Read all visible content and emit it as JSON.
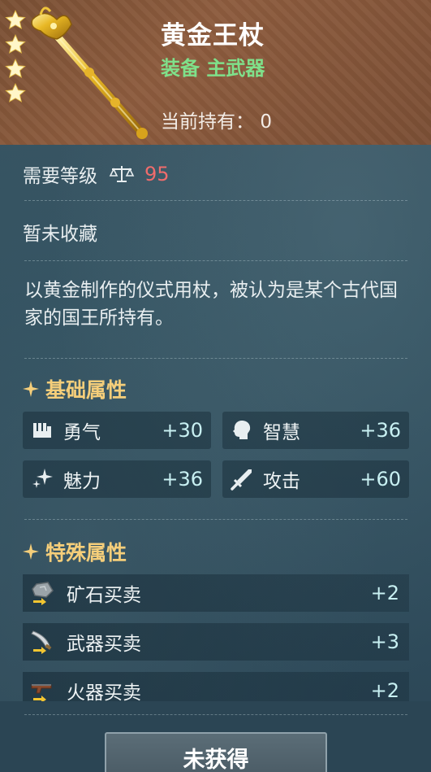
{
  "item": {
    "name": "黄金王杖",
    "type": "装备 主武器",
    "owned_label": "当前持有",
    "owned_sep": "：",
    "owned_count": "0",
    "stars": 4
  },
  "requirement": {
    "label": "需要等级",
    "icon": "scale-icon",
    "value": "95",
    "value_color": "#f06c6c"
  },
  "collection_status": "暂未收藏",
  "description": "以黄金制作的仪式用杖，被认为是某个古代国家的国王所持有。",
  "basic_attributes": {
    "title": "基础属性",
    "items": [
      {
        "name": "勇气",
        "value": "+30",
        "icon": "fist-icon"
      },
      {
        "name": "智慧",
        "value": "+36",
        "icon": "head-icon"
      },
      {
        "name": "魅力",
        "value": "+36",
        "icon": "sparkle-icon"
      },
      {
        "name": "攻击",
        "value": "+60",
        "icon": "sword-icon"
      }
    ]
  },
  "special_attributes": {
    "title": "特殊属性",
    "items": [
      {
        "name": "矿石买卖",
        "value": "+2",
        "icon": "ore-trade-icon"
      },
      {
        "name": "武器买卖",
        "value": "+3",
        "icon": "weapon-trade-icon"
      },
      {
        "name": "火器买卖",
        "value": "+2",
        "icon": "firearm-trade-icon"
      }
    ]
  },
  "action_button": "未获得",
  "colors": {
    "accent_gold": "#f5ce7a",
    "type_green": "#7fe08a",
    "header_brown": "#8d5c3e"
  }
}
